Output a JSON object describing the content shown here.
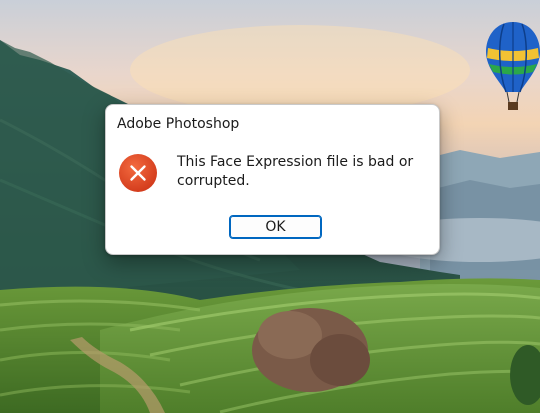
{
  "dialog": {
    "title": "Adobe Photoshop",
    "icon": "error-icon",
    "message": "This Face Expression file is bad or corrupted.",
    "ok_label": "OK"
  },
  "colors": {
    "error_icon": "#e0451f",
    "button_border": "#0067c0",
    "dialog_bg": "#ffffff"
  }
}
